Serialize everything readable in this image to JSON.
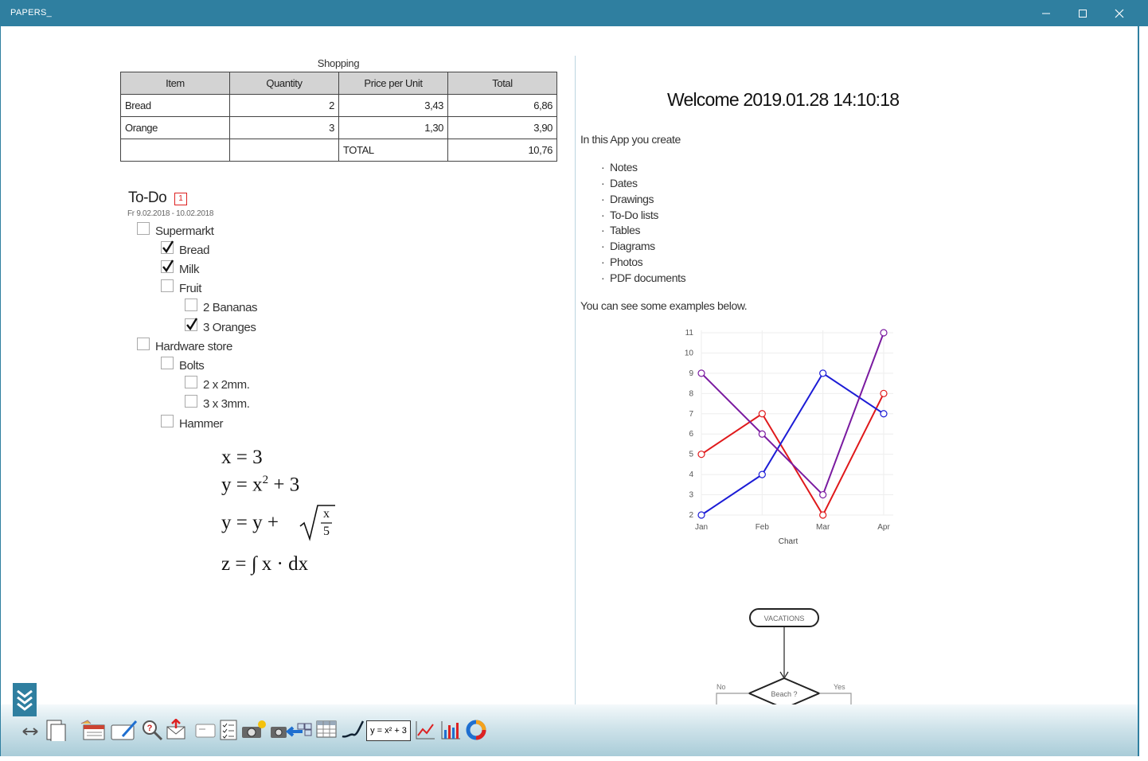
{
  "app": {
    "title": "PAPERS_"
  },
  "shopping": {
    "caption": "Shopping",
    "headers": [
      "Item",
      "Quantity",
      "Price per Unit",
      "Total"
    ],
    "rows": [
      [
        "Bread",
        "2",
        "3,43",
        "6,86"
      ],
      [
        "Orange",
        "3",
        "1,30",
        "3,90"
      ],
      [
        "",
        "",
        "TOTAL",
        "10,76"
      ]
    ]
  },
  "todo": {
    "title": "To-Do",
    "badge": "1",
    "date_range": "Fr 9.02.2018 - 10.02.2018",
    "items": [
      {
        "label": "Supermarkt",
        "checked": false
      },
      {
        "label": "Bread",
        "checked": true
      },
      {
        "label": "Milk",
        "checked": true
      },
      {
        "label": "Fruit",
        "checked": false
      },
      {
        "label": "2 Bananas",
        "checked": false
      },
      {
        "label": "3 Oranges",
        "checked": true
      },
      {
        "label": "Hardware store",
        "checked": false
      },
      {
        "label": "Bolts",
        "checked": false
      },
      {
        "label": "2 x 2mm.",
        "checked": false
      },
      {
        "label": "3 x 3mm.",
        "checked": false
      },
      {
        "label": "Hammer",
        "checked": false
      }
    ]
  },
  "formulas": {
    "f1": "x = 3",
    "f2_a": "y = x",
    "f2_exp": "2",
    "f2_b": " + 3",
    "f3_a": "y = y + ",
    "f3_num": "x",
    "f3_den": "5",
    "f4": "z = ∫ x · dx"
  },
  "welcome": {
    "heading": "Welcome 2019.01.28 14:10:18",
    "intro": "In this App you create",
    "bullets": [
      "Notes",
      "Dates",
      "Drawings",
      "To-Do lists",
      "Tables",
      "Diagrams",
      "Photos",
      "PDF documents"
    ],
    "examples": "You can see some examples below."
  },
  "chart_data": {
    "type": "line",
    "categories": [
      "Jan",
      "Feb",
      "Mar",
      "Apr"
    ],
    "series": [
      {
        "values": [
          5,
          7,
          2,
          8
        ],
        "color": "#e0191b"
      },
      {
        "values": [
          2,
          4,
          9,
          7
        ],
        "color": "#1c1cd6"
      },
      {
        "values": [
          9,
          6,
          3,
          11
        ],
        "color": "#7a1aa0"
      }
    ],
    "y_ticks": [
      "2",
      "3",
      "4",
      "5",
      "6",
      "7",
      "8",
      "9",
      "10",
      "11"
    ],
    "ylim": [
      2,
      11
    ],
    "xlabel": "Chart",
    "grid": true
  },
  "flowchart": {
    "start": "VACATIONS",
    "decision": "Beach ?",
    "no": "No",
    "yes": "Yes"
  },
  "toolbar": {
    "formula_label": "y = x² + 3",
    "icons": [
      "swap-arrows-icon",
      "documents-icon",
      "calendar-icon",
      "note-pen-icon",
      "search-help-icon",
      "send-mail-icon",
      "text-box-icon",
      "checklist-icon",
      "camera-sun-icon",
      "camera-import-icon",
      "table-icon",
      "signature-icon",
      "formula-icon",
      "line-chart-icon",
      "bar-chart-icon",
      "donut-chart-icon"
    ]
  }
}
